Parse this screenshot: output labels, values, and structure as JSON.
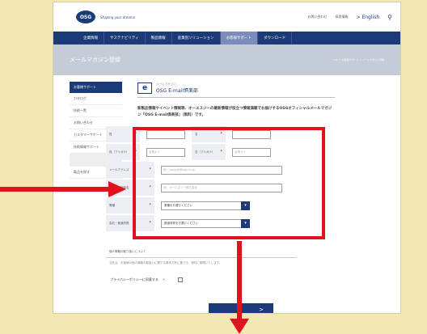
{
  "header": {
    "logo_text": "OSG",
    "tagline": "Shaping your dreams",
    "links": [
      "お問い合わせ",
      "採用情報"
    ],
    "english_link": "> English"
  },
  "nav": {
    "items": [
      "企業情報",
      "サステナビリティ",
      "製品情報",
      "産業別ソリューション",
      "お客様サポート",
      "ダウンロード"
    ]
  },
  "banner": {
    "title": "メールマガジン登録",
    "breadcrumb": "TOP > お客様サポート > メールマガジン登録"
  },
  "sidebar": {
    "heading": "お客様サポート",
    "items": [
      "カタログ",
      "技術一覧",
      "お問い合わせ",
      "カスタマーサポート",
      "技術情報サポート",
      "製品を探す"
    ]
  },
  "main": {
    "title_sub": "メールマガジン",
    "title": "OSG E-mail倶楽部",
    "mail_icon": "e",
    "intro": "新製品情報やイベント情報等、オーエスジーの最新情報が役立つ情報満載でお届けするOSGオフィシャルメールマガジン「OSG E-mail倶楽部」（無料）です。"
  },
  "form": {
    "required_mark": "*",
    "sei_label": "姓",
    "mei_label": "名",
    "sei_kana_label": "姓（フリガナ）",
    "mei_kana_label": "名（フリガナ）",
    "kana_placeholder": "全角カナ",
    "email_label": "メールアドレス",
    "email_placeholder": "例：sample@osg.co.jp",
    "company_label": "会社名・団体名",
    "company_placeholder": "例：オーエスジー株式会社",
    "industry_label": "業種",
    "industry_value": "業種をお選びください",
    "region_label": "会社・都道府県",
    "region_value": "都道府県をお選びください"
  },
  "privacy": {
    "title": "個人情報の取り扱いについて",
    "body": "当社は、お客様の個人情報の取扱いに関する基本方針に基づき、適切に管理いたします。",
    "agree_label": "プライバシーポリシーに同意する"
  },
  "submit": {
    "label": ">"
  },
  "colors": {
    "brand_blue": "#1d3a78",
    "highlight_red": "#e0121c",
    "background": "#f3e7b4"
  }
}
